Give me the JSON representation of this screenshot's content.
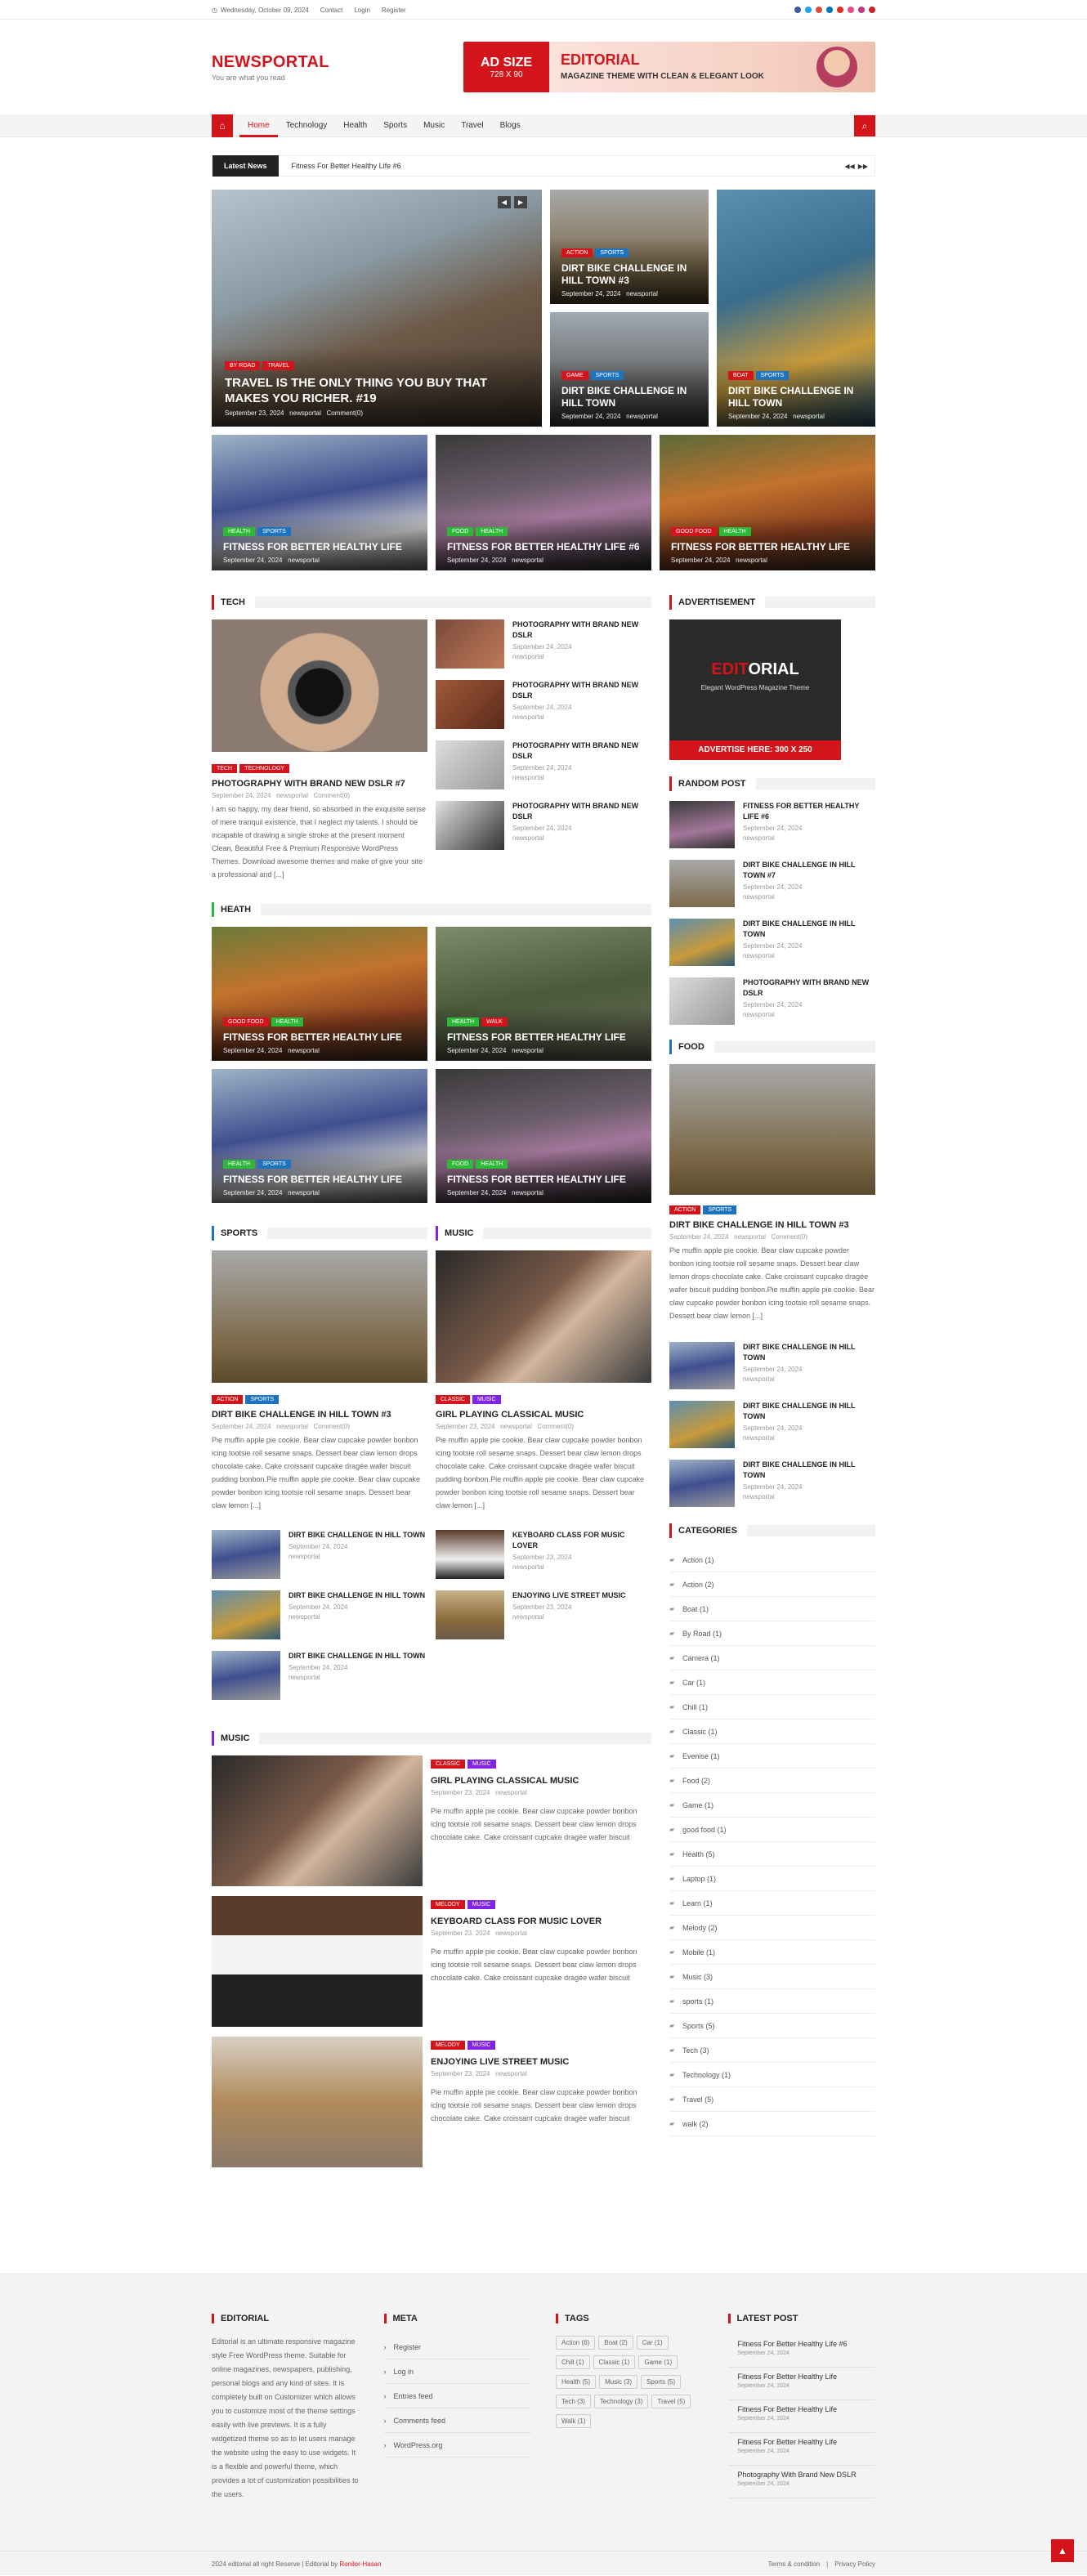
{
  "topbar": {
    "date": "Wednesday, October 09, 2024",
    "contact": "Contact",
    "login": "Login",
    "register": "Register"
  },
  "header": {
    "logo": "NEWSPORTAL",
    "tagline": "You are what you read",
    "ad_size": "AD SIZE",
    "ad_dim": "728 X 90",
    "ad_title": "EDITORIAL",
    "ad_sub": "MAGAZINE THEME WITH CLEAN & ELEGANT LOOK"
  },
  "nav": {
    "items": [
      "Home",
      "Technology",
      "Health",
      "Sports",
      "Music",
      "Travel",
      "Blogs"
    ]
  },
  "ticker": {
    "label": "Latest News",
    "text": "Fitness For Better Healthy Life #6"
  },
  "hero": {
    "big": {
      "tags": [
        "By Road",
        "Travel"
      ],
      "title": "TRAVEL IS THE ONLY THING YOU BUY THAT MAKES YOU RICHER. #19",
      "date": "September 23, 2024",
      "author": "newsportal",
      "comments": "Comment(0)"
    },
    "s1": {
      "tags": [
        "Action",
        "Sports"
      ],
      "title": "DIRT BIKE CHALLENGE IN HILL TOWN #3",
      "date": "September 24, 2024",
      "author": "newsportal"
    },
    "s2": {
      "tags": [
        "Game",
        "Sports"
      ],
      "title": "DIRT BIKE CHALLENGE IN HILL TOWN",
      "date": "September 24, 2024",
      "author": "newsportal"
    },
    "s3": {
      "tags": [
        "Boat",
        "Sports"
      ],
      "title": "DIRT BIKE CHALLENGE IN HILL TOWN",
      "date": "September 24, 2024",
      "author": "newsportal"
    },
    "r1": {
      "tags": [
        "Health",
        "Sports"
      ],
      "title": "FITNESS FOR BETTER HEALTHY LIFE",
      "date": "September 24, 2024",
      "author": "newsportal"
    },
    "r2": {
      "tags": [
        "Food",
        "Health"
      ],
      "title": "FITNESS FOR BETTER HEALTHY LIFE #6",
      "date": "September 24, 2024",
      "author": "newsportal"
    },
    "r3": {
      "tags": [
        "Good Food",
        "Health"
      ],
      "title": "FITNESS FOR BETTER HEALTHY LIFE",
      "date": "September 24, 2024",
      "author": "newsportal"
    }
  },
  "tech": {
    "heading": "TECH",
    "tags": [
      "Tech",
      "Technology"
    ],
    "title": "PHOTOGRAPHY WITH BRAND NEW DSLR #7",
    "date": "September 24, 2024",
    "author": "newsportal",
    "comments": "Comment(0)",
    "excerpt": "I am so happy, my dear friend, so absorbed in the exquisite sense of mere tranquil existence, that I neglect my talents. I should be incapable of drawing a single stroke at the present moment Clean, Beautiful Free & Premium Responsive WordPress Themes. Download awesome themes and make of give your site a professional and [...]",
    "list": [
      {
        "title": "PHOTOGRAPHY WITH BRAND NEW DSLR",
        "date": "September 24, 2024",
        "author": "newsportal"
      },
      {
        "title": "PHOTOGRAPHY WITH BRAND NEW DSLR",
        "date": "September 24, 2024",
        "author": "newsportal"
      },
      {
        "title": "PHOTOGRAPHY WITH BRAND NEW DSLR",
        "date": "September 24, 2024",
        "author": "newsportal"
      },
      {
        "title": "PHOTOGRAPHY WITH BRAND NEW DSLR",
        "date": "September 24, 2024",
        "author": "newsportal"
      }
    ]
  },
  "heath": {
    "heading": "HEATH",
    "cards": [
      {
        "tags": [
          "Good Food",
          "Health"
        ],
        "title": "FITNESS FOR BETTER HEALTHY LIFE",
        "date": "September 24, 2024",
        "author": "newsportal"
      },
      {
        "tags": [
          "Health",
          "Walk"
        ],
        "title": "FITNESS FOR BETTER HEALTHY LIFE",
        "date": "September 24, 2024",
        "author": "newsportal"
      },
      {
        "tags": [
          "Health",
          "Sports"
        ],
        "title": "FITNESS FOR BETTER HEALTHY LIFE",
        "date": "September 24, 2024",
        "author": "newsportal"
      },
      {
        "tags": [
          "Food",
          "Health"
        ],
        "title": "FITNESS FOR BETTER HEALTHY LIFE",
        "date": "September 24, 2024",
        "author": "newsportal"
      }
    ]
  },
  "sports": {
    "heading": "SPORTS",
    "tags": [
      "Action",
      "Sports"
    ],
    "title": "DIRT BIKE CHALLENGE IN HILL TOWN #3",
    "date": "September 24, 2024",
    "author": "newsportal",
    "comments": "Comment(0)",
    "excerpt": "Pie muffin apple pie cookie. Bear claw cupcake powder bonbon icing tootsie roll sesame snaps. Dessert bear claw lemon drops chocolate cake. Cake croissant cupcake dragée wafer biscuit pudding bonbon.Pie muffin apple pie cookie. Bear claw cupcake powder bonbon icing tootsie roll sesame snaps. Dessert bear claw lemon [...]",
    "list": [
      {
        "title": "DIRT BIKE CHALLENGE IN HILL TOWN",
        "date": "September 24, 2024",
        "author": "newsportal"
      },
      {
        "title": "DIRT BIKE CHALLENGE IN HILL TOWN",
        "date": "September 24, 2024",
        "author": "newsportal"
      },
      {
        "title": "DIRT BIKE CHALLENGE IN HILL TOWN",
        "date": "September 24, 2024",
        "author": "newsportal"
      }
    ]
  },
  "music": {
    "heading": "MUSIC",
    "tags": [
      "Classic",
      "Music"
    ],
    "title": "GIRL PLAYING CLASSICAL MUSIC",
    "date": "September 23, 2024",
    "author": "newsportal",
    "comments": "Comment(0)",
    "excerpt": "Pie muffin apple pie cookie. Bear claw cupcake powder bonbon icing tootsie roll sesame snaps. Dessert bear claw lemon drops chocolate cake. Cake croissant cupcake dragée wafer biscuit pudding bonbon.Pie muffin apple pie cookie. Bear claw cupcake powder bonbon icing tootsie roll sesame snaps. Dessert bear claw lemon [...]",
    "list": [
      {
        "title": "KEYBOARD CLASS FOR MUSIC LOVER",
        "date": "September 23, 2024",
        "author": "newsportal"
      },
      {
        "title": "ENJOYING LIVE STREET MUSIC",
        "date": "September 23, 2024",
        "author": "newsportal"
      }
    ]
  },
  "music2": {
    "heading": "MUSIC",
    "items": [
      {
        "tags": [
          "Classic",
          "Music"
        ],
        "title": "GIRL PLAYING CLASSICAL MUSIC",
        "date": "September 23, 2024",
        "author": "newsportal",
        "excerpt": "Pie muffin apple pie cookie. Bear claw cupcake powder bonbon icing tootsie roll sesame snaps. Dessert bear claw lemon drops chocolate cake. Cake croissant cupcake dragée wafer biscuit"
      },
      {
        "tags": [
          "Melody",
          "Music"
        ],
        "title": "KEYBOARD CLASS FOR MUSIC LOVER",
        "date": "September 23, 2024",
        "author": "newsportal",
        "excerpt": "Pie muffin apple pie cookie. Bear claw cupcake powder bonbon icing tootsie roll sesame snaps. Dessert bear claw lemon drops chocolate cake. Cake croissant cupcake dragée wafer biscuit"
      },
      {
        "tags": [
          "Melody",
          "Music"
        ],
        "title": "ENJOYING LIVE STREET MUSIC",
        "date": "September 23, 2024",
        "author": "newsportal",
        "excerpt": "Pie muffin apple pie cookie. Bear claw cupcake powder bonbon icing tootsie roll sesame snaps. Dessert bear claw lemon drops chocolate cake. Cake croissant cupcake dragée wafer biscuit"
      }
    ]
  },
  "sidebar": {
    "ad_heading": "ADVERTISEMENT",
    "ad_logo_a": "EDIT",
    "ad_logo_b": "ORIAL",
    "ad_sub": "Elegant WordPress Magazine Theme",
    "ad_cta": "ADVERTISE HERE: 300 X 250",
    "random_heading": "RANDOM POST",
    "random": [
      {
        "title": "FITNESS FOR BETTER HEALTHY LIFE #6",
        "date": "September 24, 2024",
        "author": "newsportal"
      },
      {
        "title": "DIRT BIKE CHALLENGE IN HILL TOWN #7",
        "date": "September 24, 2024",
        "author": "newsportal"
      },
      {
        "title": "DIRT BIKE CHALLENGE IN HILL TOWN",
        "date": "September 24, 2024",
        "author": "newsportal"
      },
      {
        "title": "PHOTOGRAPHY WITH BRAND NEW DSLR",
        "date": "September 24, 2024",
        "author": "newsportal"
      }
    ],
    "food_heading": "FOOD",
    "food": {
      "tags": [
        "Action",
        "Sports"
      ],
      "title": "DIRT BIKE CHALLENGE IN HILL TOWN #3",
      "date": "September 24, 2024",
      "author": "newsportal",
      "comments": "Comment(0)",
      "excerpt": "Pie muffin apple pie cookie. Bear claw cupcake powder bonbon icing tootsie roll sesame snaps. Dessert bear claw lemon drops chocolate cake. Cake croissant cupcake dragée wafer biscuit pudding bonbon.Pie muffin apple pie cookie. Bear claw cupcake powder bonbon icing tootsie roll sesame snaps. Dessert bear claw lemon [...]"
    },
    "food_list": [
      {
        "title": "DIRT BIKE CHALLENGE IN HILL TOWN",
        "date": "September 24, 2024",
        "author": "newsportal"
      },
      {
        "title": "DIRT BIKE CHALLENGE IN HILL TOWN",
        "date": "September 24, 2024",
        "author": "newsportal"
      },
      {
        "title": "DIRT BIKE CHALLENGE IN HILL TOWN",
        "date": "September 24, 2024",
        "author": "newsportal"
      }
    ],
    "cat_heading": "CATEGORIES",
    "categories": [
      "Action (1)",
      "Action (2)",
      "Boat (1)",
      "By Road (1)",
      "Camera (1)",
      "Car (1)",
      "Chill (1)",
      "Classic (1)",
      "Evenise (1)",
      "Food (2)",
      "Game (1)",
      "good food (1)",
      "Health (5)",
      "Laptop (1)",
      "Learn (1)",
      "Melody (2)",
      "Mobile (1)",
      "Music (3)",
      "sports (1)",
      "Sports (5)",
      "Tech (3)",
      "Technology (1)",
      "Travel (5)",
      "walk (2)"
    ]
  },
  "footer": {
    "editorial_h": "EDITORIAL",
    "editorial_text": "Editorial is an ultimate responsive magazine style Free WordPress theme. Suitable for online magazines, newspapers, publishing, personal blogs and any kind of sites. It is completely built on Customizer which allows you to customize most of the theme settings easily with live previews. It is a fully widgetized theme so as to let users manage the website using the easy to use widgets. It is a flexible and powerful theme, which provides a lot of customization possibilities to the users.",
    "meta_h": "META",
    "meta": [
      "Register",
      "Log in",
      "Entries feed",
      "Comments feed",
      "WordPress.org"
    ],
    "tags_h": "TAGS",
    "tags": [
      "Action (6)",
      "Boat (2)",
      "Car (1)",
      "Chill (1)",
      "Classic (1)",
      "Game (1)",
      "Health (5)",
      "Music (3)",
      "Sports (5)",
      "Tech (3)",
      "Technology (3)",
      "Travel (5)",
      "Walk (1)"
    ],
    "latest_h": "LATEST POST",
    "latest": [
      {
        "title": "Fitness For Better Healthy Life #6",
        "date": "September 24, 2024"
      },
      {
        "title": "Fitness For Better Healthy Life",
        "date": "September 24, 2024"
      },
      {
        "title": "Fitness For Better Healthy Life",
        "date": "September 24, 2024"
      },
      {
        "title": "Fitness For Better Healthy Life",
        "date": "September 24, 2024"
      },
      {
        "title": "Photography With Brand New DSLR",
        "date": "September 24, 2024"
      }
    ],
    "copy_a": "2024 editorial all right Reserve | Editorial by",
    "copy_b": "Ronilor-Hasan",
    "terms": "Terms & condition",
    "privacy": "Privacy Policy"
  },
  "colors": {
    "accent": "#d4141b",
    "blue": "#1e73be",
    "green": "#2db838",
    "purple": "#8224e3"
  }
}
